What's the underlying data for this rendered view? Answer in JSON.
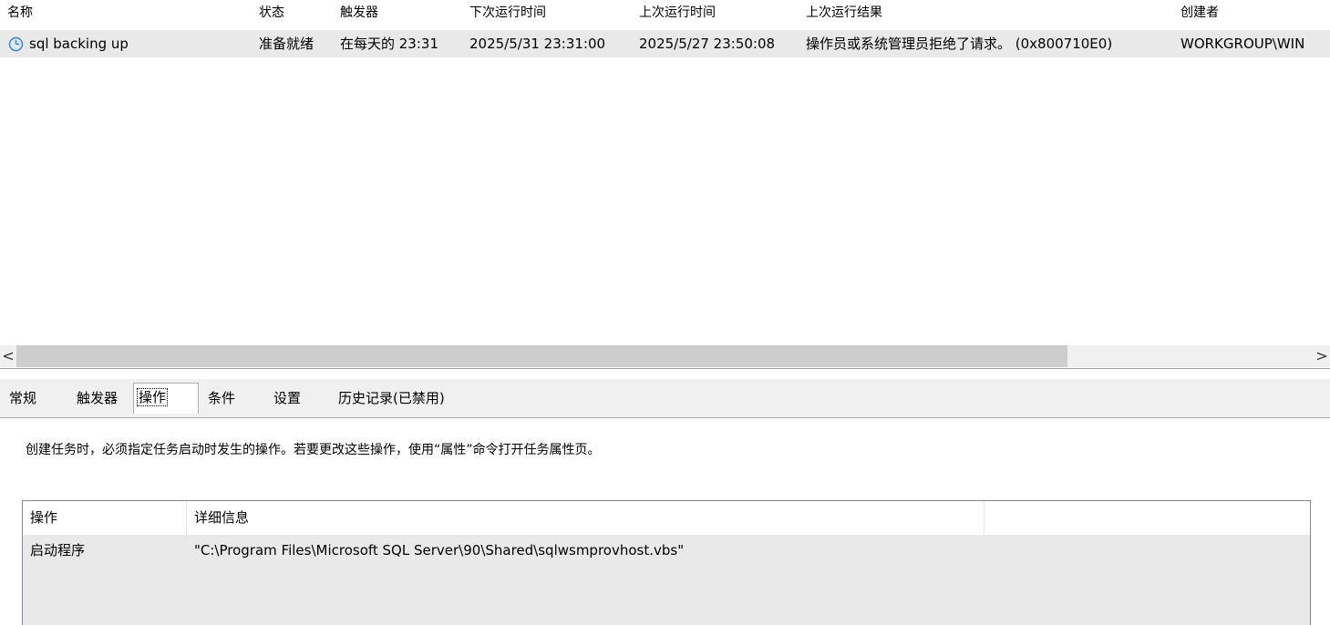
{
  "task_list": {
    "columns": [
      "名称",
      "状态",
      "触发器",
      "下次运行时间",
      "上次运行时间",
      "上次运行结果",
      "创建者"
    ],
    "rows": [
      {
        "icon": "clock-icon",
        "name": "sql backing up",
        "status": "准备就绪",
        "trigger": "在每天的 23:31",
        "next_run": "2025/5/31 23:31:00",
        "last_run": "2025/5/27 23:50:08",
        "last_result": "操作员或系统管理员拒绝了请求。 (0x800710E0)",
        "author": "WORKGROUP\\WIN"
      }
    ]
  },
  "scrollbar": {
    "left_arrow": "<",
    "right_arrow": ">"
  },
  "detail": {
    "tabs": [
      "常规",
      "触发器",
      "操作",
      "条件",
      "设置",
      "历史记录(已禁用)"
    ],
    "active_tab": "操作",
    "description": "创建任务时，必须指定任务启动时发生的操作。若要更改这些操作，使用“属性”命令打开任务属性页。",
    "actions_table": {
      "columns": [
        "操作",
        "详细信息"
      ],
      "rows": [
        {
          "action": "启动程序",
          "details": "\"C:\\Program Files\\Microsoft SQL Server\\90\\Shared\\sqlwsmprovhost.vbs\""
        }
      ]
    }
  },
  "colors": {
    "selected_row": "#e9e9e9",
    "pane_background": "#f0f0f0",
    "clock_icon": "#3c7fd1"
  }
}
